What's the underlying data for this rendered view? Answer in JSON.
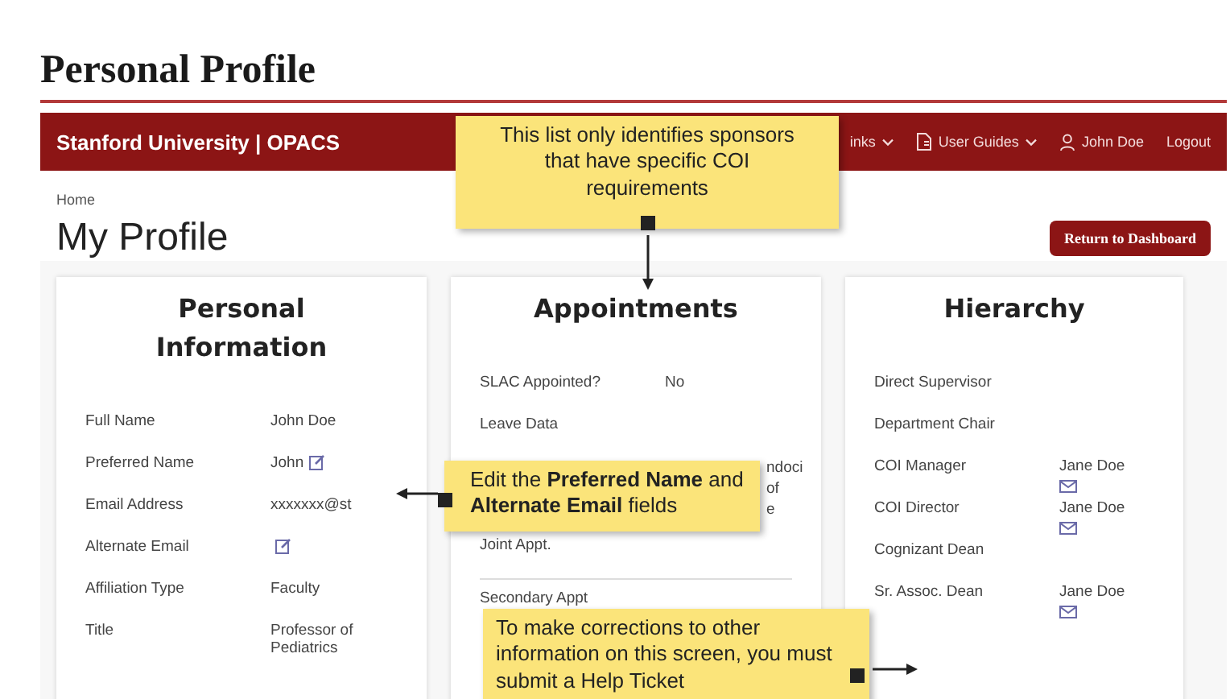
{
  "page_title": "Personal Profile",
  "nav": {
    "brand": "Stanford University | OPACS",
    "items": [
      {
        "label": "inks",
        "kind": "plain",
        "dropdown": true
      },
      {
        "label": "User Guides",
        "kind": "document",
        "dropdown": true
      },
      {
        "label": "John Doe",
        "kind": "person",
        "dropdown": false
      },
      {
        "label": "Logout",
        "kind": "plain",
        "dropdown": false
      }
    ]
  },
  "breadcrumb": "Home",
  "heading": "My Profile",
  "return_button": "Return to Dashboard",
  "cards": [
    {
      "title": "Personal Information",
      "rows": [
        {
          "kind": "field",
          "label": "Full Name",
          "value": "John Doe"
        },
        {
          "kind": "editable",
          "label": "Preferred Name",
          "value": "John"
        },
        {
          "kind": "field",
          "label": "Email Address",
          "value": "xxxxxxx@st"
        },
        {
          "kind": "editable",
          "label": "Alternate Email"
        },
        {
          "kind": "field",
          "label": "Affiliation Type",
          "value": "Faculty"
        },
        {
          "kind": "field",
          "label": "Title",
          "value": "Professor of Pediatrics"
        }
      ]
    },
    {
      "title": "Appointments",
      "rows": [
        {
          "kind": "field",
          "label": "SLAC Appointed?",
          "value": "No"
        },
        {
          "kind": "field",
          "label": "Leave Data"
        },
        {
          "kind": "fragment",
          "lines": [
            "ndoci",
            "of",
            "e"
          ]
        },
        {
          "kind": "field",
          "label": "Joint Appt."
        },
        {
          "kind": "field",
          "label": "Secondary Appt"
        }
      ]
    },
    {
      "title": "Hierarchy",
      "rows": [
        {
          "kind": "field",
          "label": "Direct Supervisor"
        },
        {
          "kind": "field",
          "label": "Department Chair"
        },
        {
          "kind": "contact",
          "label": "COI Manager",
          "value": "Jane Doe"
        },
        {
          "kind": "contact",
          "label": "COI Director",
          "value": "Jane Doe"
        },
        {
          "kind": "field",
          "label": "Cognizant Dean"
        },
        {
          "kind": "contact",
          "label": "Sr. Assoc. Dean",
          "value": "Jane Doe"
        }
      ]
    }
  ],
  "callouts": [
    {
      "text": "This list only identifies sponsors that have specific COI requirements"
    },
    {
      "text": "Edit the **Preferred Name** and **Alternate Email** fields"
    },
    {
      "text": "To make corrections to other information on this screen, you must submit a Help Ticket"
    }
  ]
}
